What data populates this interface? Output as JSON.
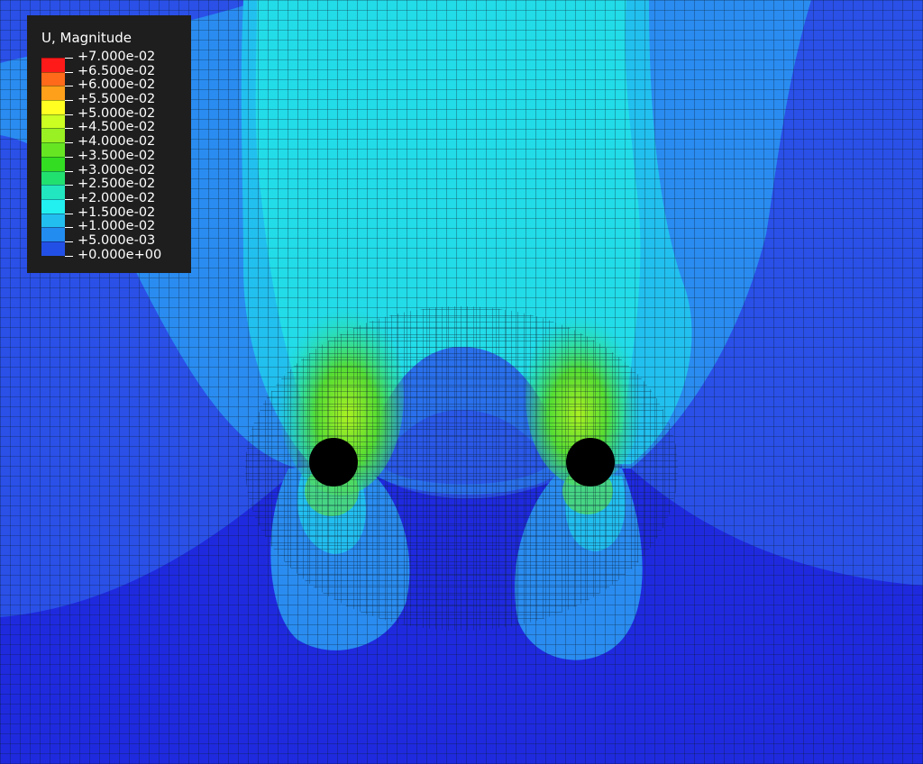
{
  "legend": {
    "title": "U, Magnitude",
    "labels": [
      "+7.000e-02",
      "+6.500e-02",
      "+6.000e-02",
      "+5.500e-02",
      "+5.000e-02",
      "+4.500e-02",
      "+4.000e-02",
      "+3.500e-02",
      "+3.000e-02",
      "+2.500e-02",
      "+2.000e-02",
      "+1.500e-02",
      "+1.000e-02",
      "+5.000e-03",
      "+0.000e+00"
    ],
    "colors": [
      "#ff1a1a",
      "#ff6a1a",
      "#ffa01a",
      "#ffff22",
      "#ccff22",
      "#99f022",
      "#66e622",
      "#33dd22",
      "#22e070",
      "#22e6c0",
      "#22f0f0",
      "#22bef0",
      "#228cf0",
      "#2250e6",
      "#1a1acc"
    ]
  },
  "holes": [
    {
      "name": "left-hole"
    },
    {
      "name": "right-hole"
    }
  ]
}
